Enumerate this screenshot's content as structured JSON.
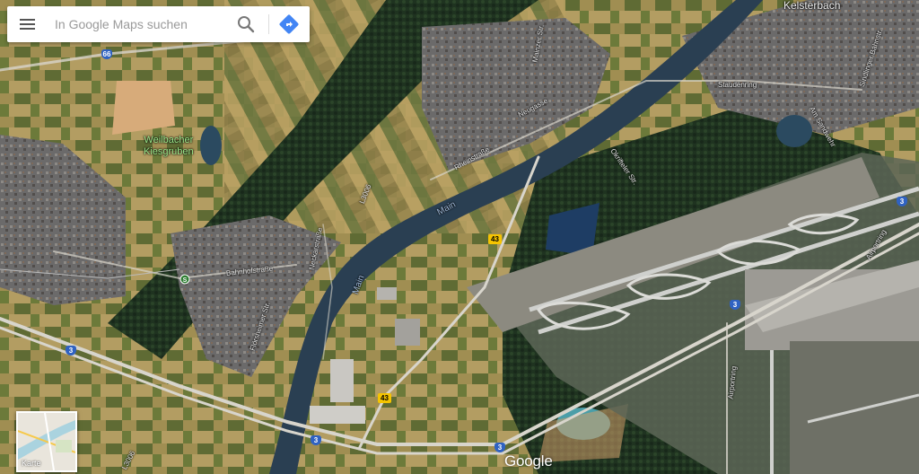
{
  "search": {
    "placeholder": "In Google Maps suchen"
  },
  "icons": {
    "menu": "menu-icon",
    "search": "search-icon",
    "directions": "directions-icon",
    "rail": "rail-station-icon"
  },
  "colors": {
    "directions_blue": "#4285f4",
    "autobahn_shield": "#2f62c2",
    "bundesstrasse_shield": "#f5c400"
  },
  "map": {
    "view": "satellite",
    "labels": {
      "town_kelsterbach": "Kelsterbach",
      "poi_line1": "Weilbacher",
      "poi_line2": "Kiesgruben",
      "river_main_1": "Main",
      "river_main_2": "Main",
      "street_rheinstrasse": "Rheinstraße",
      "street_neugasse": "Neugasse",
      "street_bahnhofstrasse": "Bahnhofstraße",
      "street_neckarstrasse": "Neckarstraße",
      "street_okriftel": "Okrifteler Str.",
      "street_floersheimer": "Flörsheimer Str.",
      "street_staudenring": "Staudenring",
      "street_am_sand": "Am Sandwehr",
      "street_airportring": "Airportring",
      "street_l3006": "L3006",
      "street_mainzer": "Mainzer Str.",
      "street_eichen": "Sindlinger Bahnstr."
    },
    "shields": {
      "b43_a": "43",
      "b43_b": "43",
      "a66": "66",
      "a3_a": "3",
      "a3_b": "3",
      "a3_c": "3",
      "a3_d": "3",
      "a3_e": "3"
    }
  },
  "layer_toggle": {
    "label": "Karte"
  },
  "branding": {
    "logo": "Google"
  }
}
